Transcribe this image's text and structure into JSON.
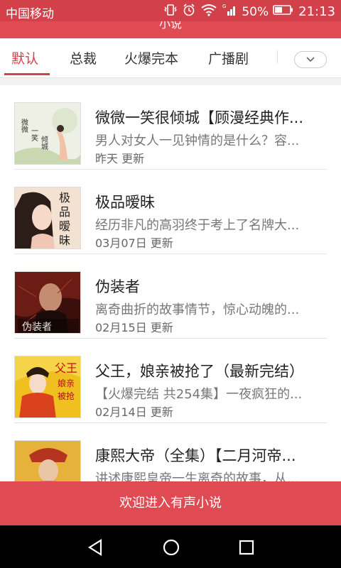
{
  "status_bar": {
    "carrier": "中国移动",
    "battery": "50%",
    "time": "21:13"
  },
  "header": {
    "title": "小说"
  },
  "tabs": [
    {
      "label": "默认",
      "active": true
    },
    {
      "label": "总裁",
      "active": false
    },
    {
      "label": "火爆完本",
      "active": false
    },
    {
      "label": "广播剧",
      "active": false
    }
  ],
  "books": [
    {
      "title": "微微一笑很倾城【顾漫经典作...",
      "desc": "男人对女人一见钟情的是什么？容...",
      "updated": "昨天 更新",
      "cover_text": "微微一笑很倾城"
    },
    {
      "title": "极品暧昧",
      "desc": "经历非凡的高羽终于考上了名牌大...",
      "updated": "03月07日 更新",
      "cover_text": "极品暧昧"
    },
    {
      "title": "伪装者",
      "desc": "离奇曲折的故事情节，惊心动魄的...",
      "updated": "02月15日 更新",
      "cover_text": "伪装者"
    },
    {
      "title": "父王，娘亲被抢了（最新完结）",
      "desc": "【火爆完结 共254集】一夜疯狂的...",
      "updated": "02月14日 更新",
      "cover_text": "父王娘亲被抢了"
    },
    {
      "title": "康熙大帝（全集）【二月河帝...",
      "desc": "讲述康熙皇帝一生离奇的故事，从...",
      "updated": "",
      "cover_text": ""
    }
  ],
  "welcome_bar": {
    "text": "欢迎进入有声小说"
  }
}
